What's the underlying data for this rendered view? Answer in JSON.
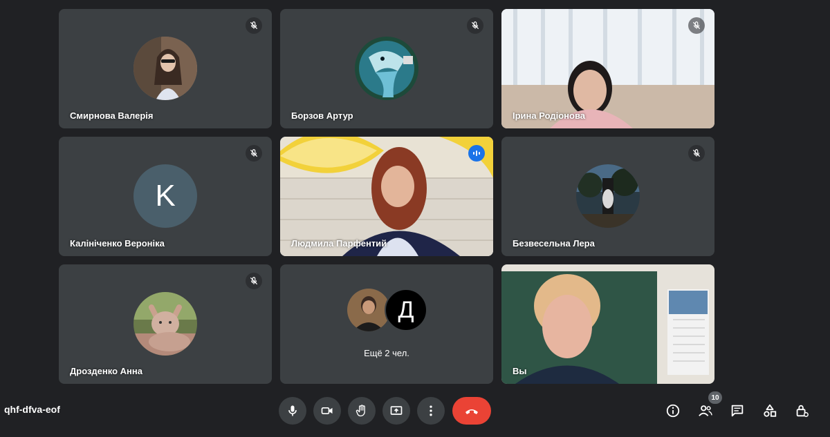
{
  "meeting": {
    "code": "qhf-dfva-eof",
    "participants_count": "10"
  },
  "tiles": [
    {
      "name": "Смирнова Валерія",
      "muted": true,
      "avatar": "photo"
    },
    {
      "name": "Борзов Артур",
      "muted": true,
      "avatar": "photo"
    },
    {
      "name": "Ірина Родіонова",
      "muted": true,
      "avatar": "video"
    },
    {
      "name": "Калініченко Вероніка",
      "muted": true,
      "avatar": "letter",
      "letter": "K"
    },
    {
      "name": "Людмила Парфентий",
      "muted": false,
      "speaking": true,
      "avatar": "video"
    },
    {
      "name": "Безвесельна Лера",
      "muted": true,
      "avatar": "photo"
    },
    {
      "name": "Дрозденко Анна",
      "muted": true,
      "avatar": "photo"
    },
    {
      "name": "Ещё 2 чел.",
      "avatar": "group",
      "group_letter": "Д"
    },
    {
      "name": "Вы",
      "avatar": "video"
    }
  ],
  "controls": {
    "left": [
      "microphone-icon",
      "camera-icon",
      "raise-hand-icon",
      "present-screen-icon",
      "more-options-icon",
      "end-call-icon"
    ],
    "right": [
      "info-icon",
      "people-icon",
      "chat-icon",
      "activities-icon",
      "host-controls-icon"
    ]
  },
  "colors": {
    "background": "#202124",
    "tile": "#3c4043",
    "end_call": "#ea4335",
    "speaking_accent": "#1a73e8"
  }
}
